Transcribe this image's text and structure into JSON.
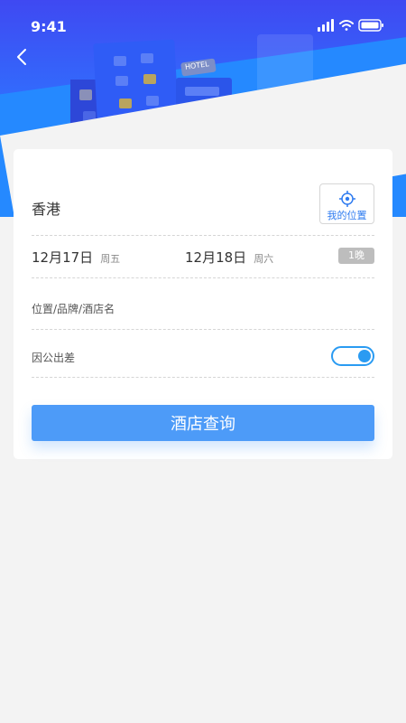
{
  "status_bar": {
    "time": "9:41"
  },
  "hero": {
    "sign_text": "HOTEL"
  },
  "form": {
    "city": "香港",
    "my_location_label": "我的位置",
    "checkin": {
      "date": "12月17日",
      "weekday": "周五"
    },
    "checkout": {
      "date": "12月18日",
      "weekday": "周六"
    },
    "nights": "1晚",
    "search_placeholder": "位置/品牌/酒店名",
    "business_trip_label": "因公出差",
    "business_trip_enabled": true,
    "submit_label": "酒店查询"
  },
  "colors": {
    "primary": "#4d9bf8",
    "toggle": "#2a9bf2",
    "hero_top": "#3f49f2",
    "hero_bottom": "#2a86ff"
  }
}
